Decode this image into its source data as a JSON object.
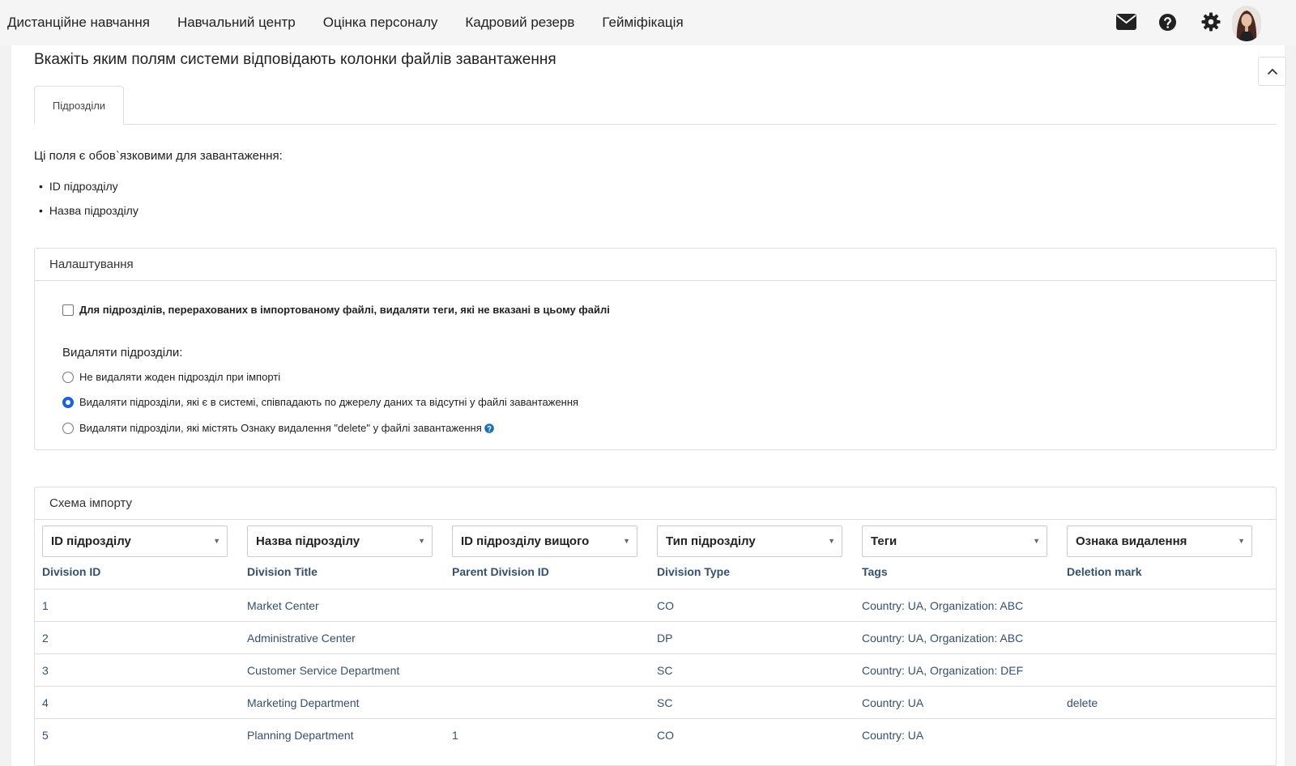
{
  "nav": {
    "items": [
      "Дистанційне навчання",
      "Навчальний центр",
      "Оцінка персоналу",
      "Кадровий резерв",
      "Гейміфікація"
    ],
    "icons": [
      "mail-icon",
      "help-icon",
      "gear-icon",
      "avatar"
    ]
  },
  "page": {
    "title": "Вкажіть яким полям системи відповідають колонки файлів завантаження",
    "tab_label": "Підрозділи",
    "required_text": "Ці поля є обов`язковими для завантаження:",
    "required_fields": [
      "ID підрозділу",
      "Назва підрозділу"
    ]
  },
  "settings": {
    "title": "Налаштування",
    "checkbox_label": "Для підрозділів, перерахованих в імпортованому файлі, видаляти теги, які не вказані в цьому файлі",
    "checkbox_checked": false,
    "delete_label": "Видаляти підрозділи:",
    "radio_options": [
      "Не видаляти жоден підрозділ при імпорті",
      "Видаляти підрозділи, які є в системі, співпадають по джерелу даних та відсутні у файлі завантаження",
      "Видаляти підрозділи, які містять Ознаку видалення \"delete\" у файлі завантаження"
    ],
    "selected_radio": 1
  },
  "schema": {
    "title": "Схема імпорту",
    "selects": [
      "ID підрозділу",
      "Назва підрозділу",
      "ID підрозділу вищого",
      "Тип підрозділу",
      "Теги",
      "Ознака видалення"
    ],
    "columns": [
      "Division ID",
      "Division Title",
      "Parent Division ID",
      "Division Type",
      "Tags",
      "Deletion mark"
    ],
    "rows": [
      [
        "1",
        "Market Center",
        "",
        "CO",
        "Country: UA, Organization: ABC",
        ""
      ],
      [
        "2",
        "Administrative Center",
        "",
        "DP",
        "Country: UA, Organization: ABC",
        ""
      ],
      [
        "3",
        "Customer Service Department",
        "",
        "SC",
        "Country: UA, Organization: DEF",
        ""
      ],
      [
        "4",
        "Marketing Department",
        "",
        "SC",
        "Country: UA",
        "delete"
      ],
      [
        "5",
        "Planning Department",
        "1",
        "CO",
        "Country: UA",
        ""
      ]
    ]
  }
}
